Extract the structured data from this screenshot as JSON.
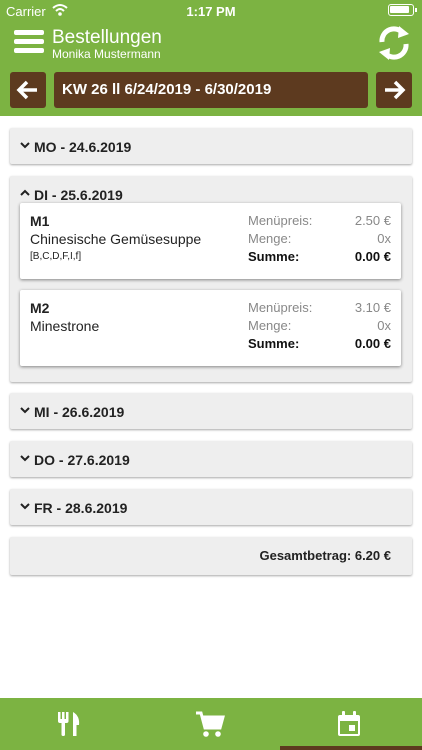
{
  "status_bar": {
    "carrier": "Carrier",
    "time": "1:17 PM"
  },
  "header": {
    "title": "Bestellungen",
    "subtitle": "Monika Mustermann"
  },
  "week": {
    "label": "KW 26 ll 6/24/2019 - 6/30/2019"
  },
  "days": [
    {
      "label": "MO - 24.6.2019",
      "expanded": false
    },
    {
      "label": "DI - 25.6.2019",
      "expanded": true,
      "meals": [
        {
          "code": "M1",
          "name": "Chinesische Gemüsesuppe",
          "allergens": "[B,C,D,F,I,f]",
          "price_label": "Menüpreis:",
          "price": "2.50 €",
          "qty_label": "Menge:",
          "qty": "0x",
          "sum_label": "Summe:",
          "sum": "0.00 €"
        },
        {
          "code": "M2",
          "name": "Minestrone",
          "allergens": "",
          "price_label": "Menüpreis:",
          "price": "3.10 €",
          "qty_label": "Menge:",
          "qty": "0x",
          "sum_label": "Summe:",
          "sum": "0.00 €"
        }
      ]
    },
    {
      "label": "MI - 26.6.2019",
      "expanded": false
    },
    {
      "label": "DO - 27.6.2019",
      "expanded": false
    },
    {
      "label": "FR - 28.6.2019",
      "expanded": false
    }
  ],
  "total": {
    "text": "Gesamtbetrag: 6.20 €"
  },
  "tabs": [
    {
      "icon": "fork-knife-icon",
      "active": false
    },
    {
      "icon": "cart-icon",
      "active": false
    },
    {
      "icon": "calendar-icon",
      "active": true
    }
  ],
  "colors": {
    "primary_green": "#7cb342",
    "accent_brown": "#5d3a1f",
    "card_grey": "#eeeeee"
  }
}
